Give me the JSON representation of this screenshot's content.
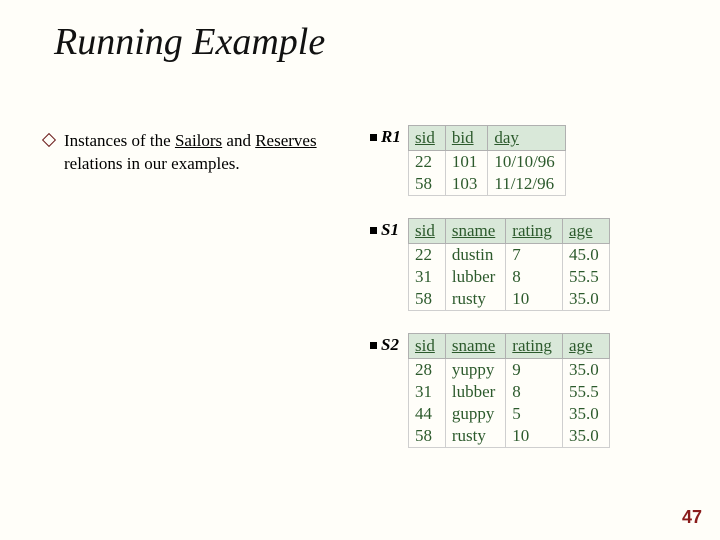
{
  "title": "Running Example",
  "body": {
    "prefix": "Instances of the ",
    "u1": "Sailors",
    "mid": " and ",
    "u2": "Reserves",
    "suffix": " relations in our examples."
  },
  "tables": {
    "r1": {
      "label": "R1",
      "headers": [
        "sid",
        "bid",
        "day"
      ],
      "rows": [
        [
          "22",
          "101",
          "10/10/96"
        ],
        [
          "58",
          "103",
          "11/12/96"
        ]
      ]
    },
    "s1": {
      "label": "S1",
      "headers": [
        "sid",
        "sname",
        "rating",
        "age"
      ],
      "rows": [
        [
          "22",
          "dustin",
          "7",
          "45.0"
        ],
        [
          "31",
          "lubber",
          "8",
          "55.5"
        ],
        [
          "58",
          "rusty",
          "10",
          "35.0"
        ]
      ]
    },
    "s2": {
      "label": "S2",
      "headers": [
        "sid",
        "sname",
        "rating",
        "age"
      ],
      "rows": [
        [
          "28",
          "yuppy",
          "9",
          "35.0"
        ],
        [
          "31",
          "lubber",
          "8",
          "55.5"
        ],
        [
          "44",
          "guppy",
          "5",
          "35.0"
        ],
        [
          "58",
          "rusty",
          "10",
          "35.0"
        ]
      ]
    }
  },
  "pagenum": "47"
}
